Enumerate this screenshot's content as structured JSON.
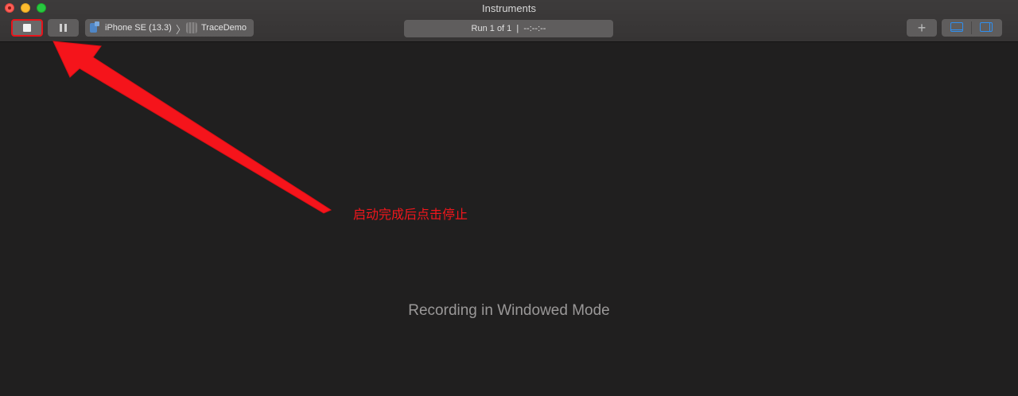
{
  "window": {
    "title": "Instruments"
  },
  "toolbar": {
    "device": "iPhone SE (13.3)",
    "app": "TraceDemo",
    "run_status": "Run 1 of 1  |  --:--:--",
    "stop_icon": "stop-icon",
    "pause_icon": "pause-icon",
    "add_icon": "plus-icon",
    "view_icons": [
      "bottom-panel-icon",
      "right-panel-icon"
    ]
  },
  "main": {
    "message": "Recording in Windowed Mode"
  },
  "annotation": {
    "text": "启动完成后点击停止",
    "color": "#f2161c"
  },
  "colors": {
    "accent": "#2f8ff0",
    "highlight_red": "#e8141b",
    "background": "#201f1f"
  }
}
